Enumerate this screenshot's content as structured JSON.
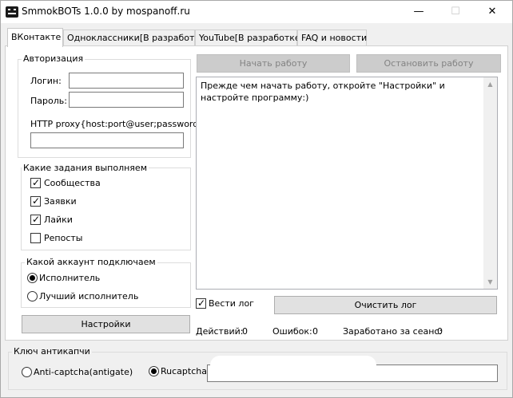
{
  "window": {
    "title": "SmmokBOTs 1.0.0 by mospanoff.ru",
    "minimize": "—",
    "maximize": "☐",
    "close": "✕"
  },
  "tabs": [
    {
      "label": "ВКонтакте"
    },
    {
      "label": "Одноклассники[В разработке]"
    },
    {
      "label": "YouTube[В разработке]"
    },
    {
      "label": "FAQ и новости"
    }
  ],
  "auth": {
    "title": "Авторизация",
    "login_label": "Логин:",
    "login_value": "",
    "password_label": "Пароль:",
    "password_value": "",
    "proxy_label": "HTTP proxy{host:port@user;password}",
    "proxy_value": ""
  },
  "tasks": {
    "title": "Какие задания выполняем",
    "items": [
      {
        "label": "Сообщества",
        "checked": true
      },
      {
        "label": "Заявки",
        "checked": true
      },
      {
        "label": "Лайки",
        "checked": true
      },
      {
        "label": "Репосты",
        "checked": false
      }
    ]
  },
  "account": {
    "title": "Какой аккаунт подключаем",
    "options": [
      {
        "label": "Исполнитель",
        "selected": true
      },
      {
        "label": "Лучший исполнитель",
        "selected": false
      }
    ]
  },
  "buttons": {
    "settings": "Настройки",
    "start": "Начать работу",
    "stop": "Остановить работу",
    "clear_log": "Очистить лог"
  },
  "log": {
    "text": "Прежде чем начать работу, откройте \"Настройки\" и настройте программу:)",
    "keep_log_label": "Вести лог",
    "keep_log_checked": true
  },
  "stats": {
    "actions_label": "Действий:",
    "actions_value": "0",
    "errors_label": "Ошибок:",
    "errors_value": "0",
    "earned_label": "Заработано за сеанс:",
    "earned_value": "0"
  },
  "captcha": {
    "title": "Ключ антикапчи",
    "options": [
      {
        "label": "Anti-captcha(antigate)",
        "selected": false
      },
      {
        "label": "Rucaptcha",
        "selected": true
      }
    ],
    "key_value": ""
  },
  "icons": {
    "app": "smmok-bots-app-icon",
    "scroll_up": "chevron-up-icon",
    "scroll_down": "chevron-down-icon"
  }
}
